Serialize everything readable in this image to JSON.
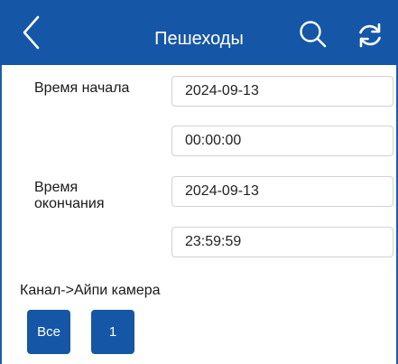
{
  "header": {
    "title": "Пешеходы",
    "accent_color": "#1656a6",
    "icons": {
      "back": "chevron-left-icon",
      "search": "search-icon",
      "refresh": "refresh-icon"
    }
  },
  "form": {
    "start_label": "Время начала",
    "start_date": "2024-09-13",
    "start_time": "00:00:00",
    "end_label_line1": "Время",
    "end_label_line2": "окончания",
    "end_date": "2024-09-13",
    "end_time": "23:59:59"
  },
  "channels": {
    "label": "Канал->Айпи камера",
    "buttons": [
      "Все",
      "1"
    ]
  }
}
